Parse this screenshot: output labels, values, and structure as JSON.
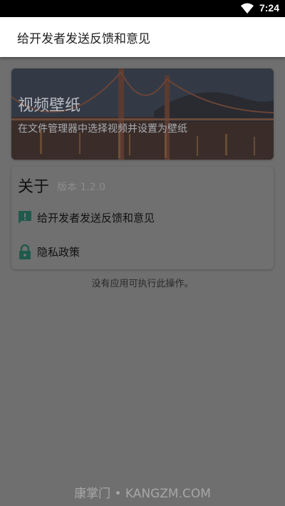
{
  "status_bar": {
    "time": "7:24",
    "wifi_icon": "wifi-icon"
  },
  "header": {
    "title": "给开发者发送反馈和意见"
  },
  "wallpaper_card": {
    "title": "视频壁纸",
    "subtitle": "在文件管理器中选择视频并设置为壁纸"
  },
  "about_card": {
    "title": "关于",
    "version": "版本 1.2.0",
    "items": [
      {
        "label": "给开发者发送反馈和意见",
        "icon": "feedback-icon"
      },
      {
        "label": "隐私政策",
        "icon": "lock-icon"
      }
    ]
  },
  "toast": "没有应用可执行此操作。",
  "watermark": "康掌门 • KANGZM.COM",
  "colors": {
    "accent": "#1f7a66",
    "scrim": "#6f6f6f"
  }
}
